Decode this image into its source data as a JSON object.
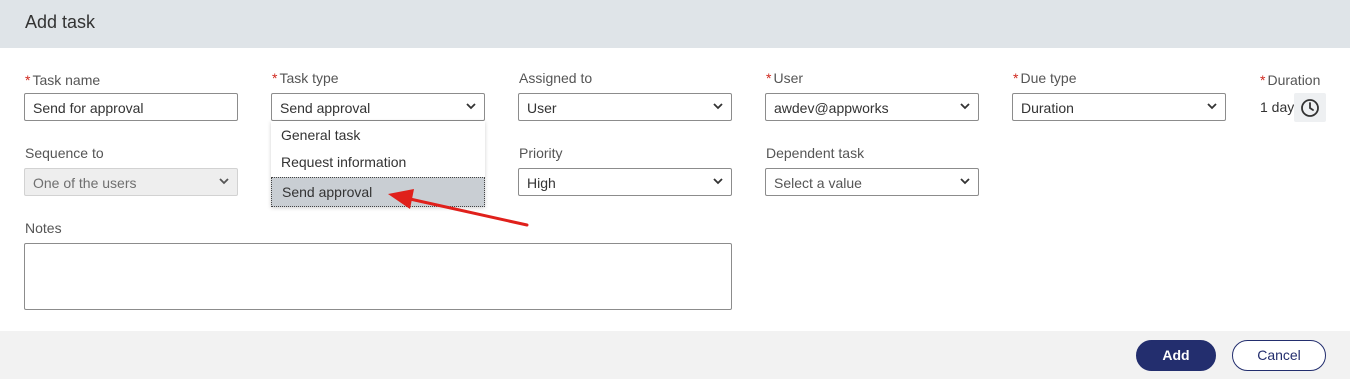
{
  "dialog": {
    "title": "Add task"
  },
  "fields": {
    "task_name": {
      "label": "Task name",
      "value": "Send for approval"
    },
    "task_type": {
      "label": "Task type",
      "value": "Send approval"
    },
    "assigned_to": {
      "label": "Assigned to",
      "value": "User"
    },
    "user": {
      "label": "User",
      "value": "awdev@appworks"
    },
    "due_type": {
      "label": "Due type",
      "value": "Duration"
    },
    "duration": {
      "label": "Duration",
      "value": "1 day"
    },
    "sequence_to": {
      "label": "Sequence to",
      "value": "One of the users"
    },
    "priority": {
      "label": "Priority",
      "value": "High"
    },
    "dependent_task": {
      "label": "Dependent task",
      "placeholder": "Select a value"
    },
    "notes": {
      "label": "Notes",
      "value": ""
    }
  },
  "task_type_dropdown": {
    "options": [
      "General task",
      "Request information",
      "Send approval"
    ],
    "selected": "Send approval"
  },
  "required_marker": "*",
  "footer": {
    "add_label": "Add",
    "cancel_label": "Cancel"
  },
  "colors": {
    "header_bg": "#dfe4e8",
    "primary": "#232e6e",
    "required": "#d0281e",
    "annotation_arrow": "#e0201b"
  }
}
